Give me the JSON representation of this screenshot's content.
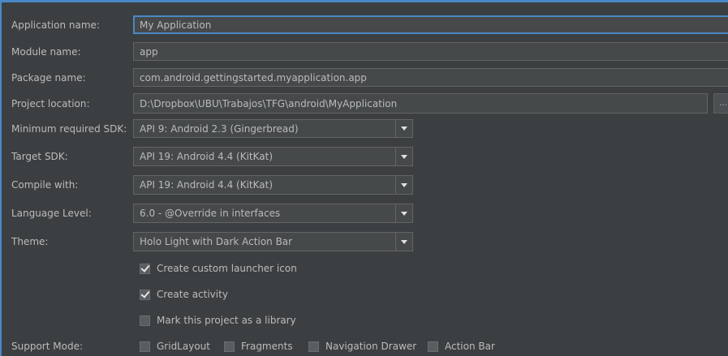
{
  "form": {
    "app_name": {
      "label": "Application name:",
      "value": "My Application"
    },
    "module_name": {
      "label": "Module name:",
      "value": "app"
    },
    "package_name": {
      "label": "Package name:",
      "value": "com.android.gettingstarted.myapplication.app"
    },
    "project_location": {
      "label": "Project location:",
      "value": "D:\\Dropbox\\UBU\\Trabajos\\TFG\\android\\MyApplication",
      "browse_label": "..."
    },
    "min_sdk": {
      "label": "Minimum required SDK:",
      "value": "API 9: Android 2.3 (Gingerbread)"
    },
    "target_sdk": {
      "label": "Target SDK:",
      "value": "API 19: Android 4.4 (KitKat)"
    },
    "compile_with": {
      "label": "Compile with:",
      "value": "API 19: Android 4.4 (KitKat)"
    },
    "language_level": {
      "label": "Language Level:",
      "value": "6.0 - @Override in interfaces"
    },
    "theme": {
      "label": "Theme:",
      "value": "Holo Light with Dark Action Bar"
    }
  },
  "options": {
    "launcher_icon": {
      "label": "Create custom launcher icon",
      "checked": true
    },
    "create_activity": {
      "label": "Create activity",
      "checked": true
    },
    "library": {
      "label": "Mark this project as a library",
      "checked": false
    }
  },
  "support_mode": {
    "label": "Support Mode:",
    "gridlayout": {
      "label": "GridLayout",
      "checked": false
    },
    "fragments": {
      "label": "Fragments",
      "checked": false
    },
    "navigation_drawer": {
      "label": "Navigation Drawer",
      "checked": false
    },
    "action_bar": {
      "label": "Action Bar",
      "checked": false
    }
  },
  "colors": {
    "accent": "#4a88c7",
    "background": "#3c3f41",
    "field": "#45494a"
  },
  "icons": [
    "chevron-down-icon",
    "checkbox-icon",
    "browse-icon"
  ]
}
